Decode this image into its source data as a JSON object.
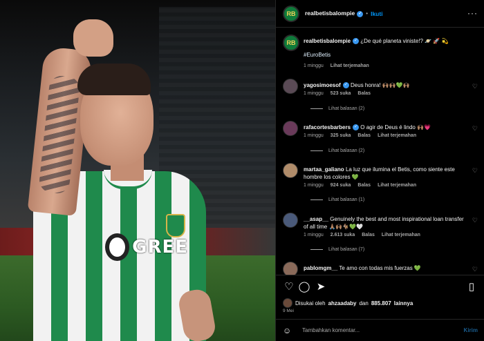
{
  "colors": {
    "verified": "#3897f0",
    "link": "#0095f6",
    "muted": "#a8a8a8",
    "betis_green": "#1f8a4c"
  },
  "header": {
    "username": "realbetisbalompie",
    "follow_label": "Ikuti",
    "more_icon": "more-options-icon"
  },
  "photo": {
    "sponsor_text": "GREE"
  },
  "caption": {
    "username": "realbetisbalompie",
    "text": "¿De qué planeta viniste!? 🪐 🚀 💫",
    "hashtag": "#EuroBetis",
    "time": "1 minggu",
    "translate": "Lihat terjemahan"
  },
  "comments": [
    {
      "username": "yagosimoesof",
      "verified": true,
      "text": "Deus honra! 🙌🏽🙌🏽💚🙌🏽",
      "time": "1 minggu",
      "likes": "523 suka",
      "reply": "Balas",
      "translate": "",
      "replies": "Lihat balasan (2)",
      "avatar_color": "#5a4a55"
    },
    {
      "username": "rafacortesbarbers",
      "verified": true,
      "text": "O agir de Deus é lindo 🙌🏽💗",
      "time": "1 minggu",
      "likes": "325 suka",
      "reply": "Balas",
      "translate": "Lihat terjemahan",
      "replies": "Lihat balasan (2)",
      "avatar_color": "#6a3a5a"
    },
    {
      "username": "martaa_galiano",
      "verified": false,
      "text": "La luz que ilumina el Betis, como siente este hombre los colores 💚",
      "time": "1 minggu",
      "likes": "924 suka",
      "reply": "Balas",
      "translate": "Lihat terjemahan",
      "replies": "Lihat balasan (1)",
      "avatar_color": "#b08c6a"
    },
    {
      "username": "__asap__",
      "verified": false,
      "text": "Genuinely the best and most inspirational loan transfer of all time 🙏🏽🙌🏽🐐💚🤍",
      "time": "1 minggu",
      "likes": "2.613 suka",
      "reply": "Balas",
      "translate": "Lihat terjemahan",
      "replies": "Lihat balasan (7)",
      "avatar_color": "#4a5a7a"
    },
    {
      "username": "pablomgm__",
      "verified": false,
      "text": "Te amo con todas mis fuerzas 💚",
      "time": "",
      "likes": "",
      "reply": "",
      "translate": "",
      "replies": "",
      "avatar_color": "#8a6a5a"
    }
  ],
  "actions": {
    "like_icon": "heart-icon",
    "comment_icon": "comment-icon",
    "share_icon": "share-icon",
    "save_icon": "bookmark-icon"
  },
  "likes": {
    "prefix": "Disukai oleh",
    "user": "ahzaadaby",
    "and": "dan",
    "count": "885.807",
    "suffix": "lainnya"
  },
  "date": "9 Mei",
  "comment_input": {
    "placeholder": "Tambahkan komentar...",
    "send": "Kirim"
  }
}
